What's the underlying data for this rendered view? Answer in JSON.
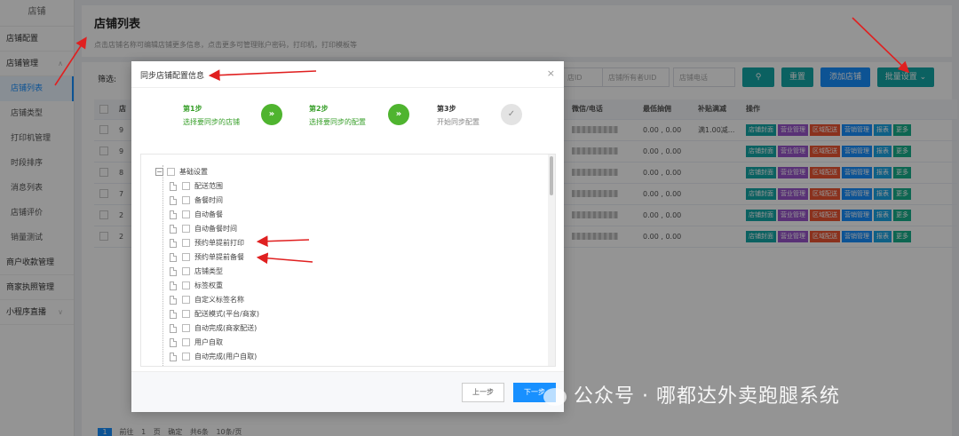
{
  "sidebar": {
    "title": "店铺",
    "items": [
      {
        "label": "店铺配置",
        "type": "group",
        "arrow": ""
      },
      {
        "label": "店铺管理",
        "type": "group",
        "arrow": "∧"
      },
      {
        "label": "店铺列表",
        "type": "sub",
        "active": true
      },
      {
        "label": "店铺类型",
        "type": "sub"
      },
      {
        "label": "打印机管理",
        "type": "sub"
      },
      {
        "label": "时段排序",
        "type": "sub"
      },
      {
        "label": "消息列表",
        "type": "sub"
      },
      {
        "label": "店铺评价",
        "type": "sub"
      },
      {
        "label": "销量测试",
        "type": "sub"
      },
      {
        "label": "商户收款管理",
        "type": "group",
        "arrow": ""
      },
      {
        "label": "商家执照管理",
        "type": "group",
        "arrow": ""
      },
      {
        "label": "小程序直播",
        "type": "group",
        "arrow": "∨"
      }
    ]
  },
  "page": {
    "title": "店铺列表",
    "description": "点击店铺名称可编辑店铺更多信息，点击更多可管理账户密码，打印机，打印模板等"
  },
  "filter": {
    "label": "筛选:",
    "input_id": "店ID",
    "input_uid": "店铺所有者UID",
    "input_phone": "店铺电话",
    "search_icon": "search-icon",
    "reset": "重置",
    "add": "添加店铺",
    "batch": "批量设置"
  },
  "table": {
    "columns": [
      "店",
      "微信/电话",
      "最低抽佣",
      "补贴满减",
      "操作"
    ],
    "rows": [
      {
        "id": "9",
        "rate": "0.00 , 0.00",
        "subsidy": "满1.00减..."
      },
      {
        "id": "9",
        "rate": "0.00 , 0.00",
        "subsidy": ""
      },
      {
        "id": "8",
        "rate": "0.00 , 0.00",
        "subsidy": ""
      },
      {
        "id": "7",
        "rate": "0.00 , 0.00",
        "subsidy": ""
      },
      {
        "id": "2",
        "rate": "0.00 , 0.00",
        "subsidy": ""
      },
      {
        "id": "2",
        "rate": "0.00 , 0.00",
        "subsidy": ""
      }
    ],
    "ops": [
      "店铺封面",
      "营业管理",
      "区域配送",
      "营销管理",
      "报表",
      "更多"
    ]
  },
  "pager": {
    "current": "1",
    "items": [
      "前往",
      "1",
      "页",
      "确定",
      "共6条",
      "10条/页"
    ]
  },
  "dialog": {
    "title": "同步店铺配置信息",
    "close": "×",
    "steps": [
      {
        "num": "第1步",
        "desc": "选择要同步的店铺",
        "state": "done"
      },
      {
        "num": "第2步",
        "desc": "选择要同步的配置",
        "state": "done"
      },
      {
        "num": "第3步",
        "desc": "开始同步配置",
        "state": "todo"
      }
    ],
    "tree": {
      "root": "基础设置",
      "children": [
        "配送范围",
        "备餐时间",
        "自动备餐",
        "自动备餐时间",
        "预约单提前打印",
        "预约单提前备餐",
        "店铺类型",
        "标签权重",
        "自定义标签名称",
        "配送模式(平台/商家)",
        "自动完成(商家配送)",
        "用户自取",
        "自动完成(用户自取)"
      ]
    },
    "prev": "上一步",
    "next": "下一步"
  },
  "watermark": "公众号 · 哪都达外卖跑腿系统",
  "colors": {
    "accent": "#1890ff",
    "green": "#4fb42f",
    "arrow": "#e02020"
  }
}
